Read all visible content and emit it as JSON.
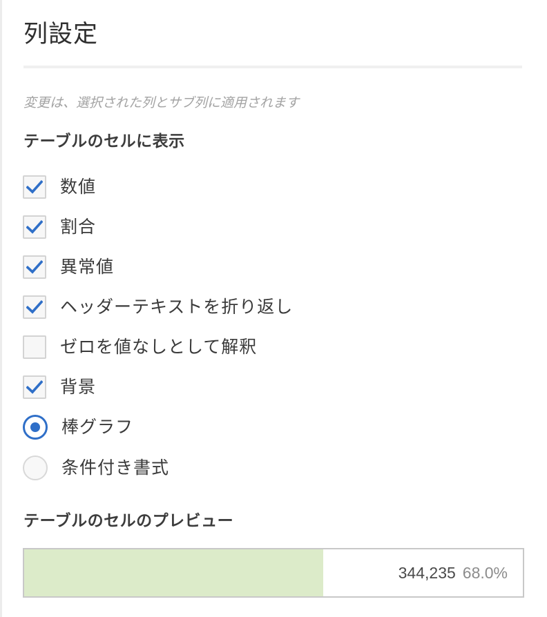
{
  "panel": {
    "title": "列設定",
    "hint": "変更は、選択された列とサブ列に適用されます"
  },
  "display_section": {
    "heading": "テーブルのセルに表示",
    "options": [
      {
        "label": "数値",
        "type": "checkbox",
        "checked": true
      },
      {
        "label": "割合",
        "type": "checkbox",
        "checked": true
      },
      {
        "label": "異常値",
        "type": "checkbox",
        "checked": true
      },
      {
        "label": "ヘッダーテキストを折り返し",
        "type": "checkbox",
        "checked": true
      },
      {
        "label": "ゼロを値なしとして解釈",
        "type": "checkbox",
        "checked": false
      },
      {
        "label": "背景",
        "type": "checkbox",
        "checked": true
      },
      {
        "label": "棒グラフ",
        "type": "radio",
        "selected": true
      },
      {
        "label": "条件付き書式",
        "type": "radio",
        "selected": false
      }
    ]
  },
  "preview_section": {
    "heading": "テーブルのセルのプレビュー",
    "value": "344,235",
    "percent": "68.0%",
    "bar_fraction": 0.6
  },
  "colors": {
    "accent": "#2f6fc8",
    "bar_fill": "#dcebc9",
    "hint_text": "#a3a3a3"
  },
  "icons": {
    "check": "checkmark-icon"
  }
}
